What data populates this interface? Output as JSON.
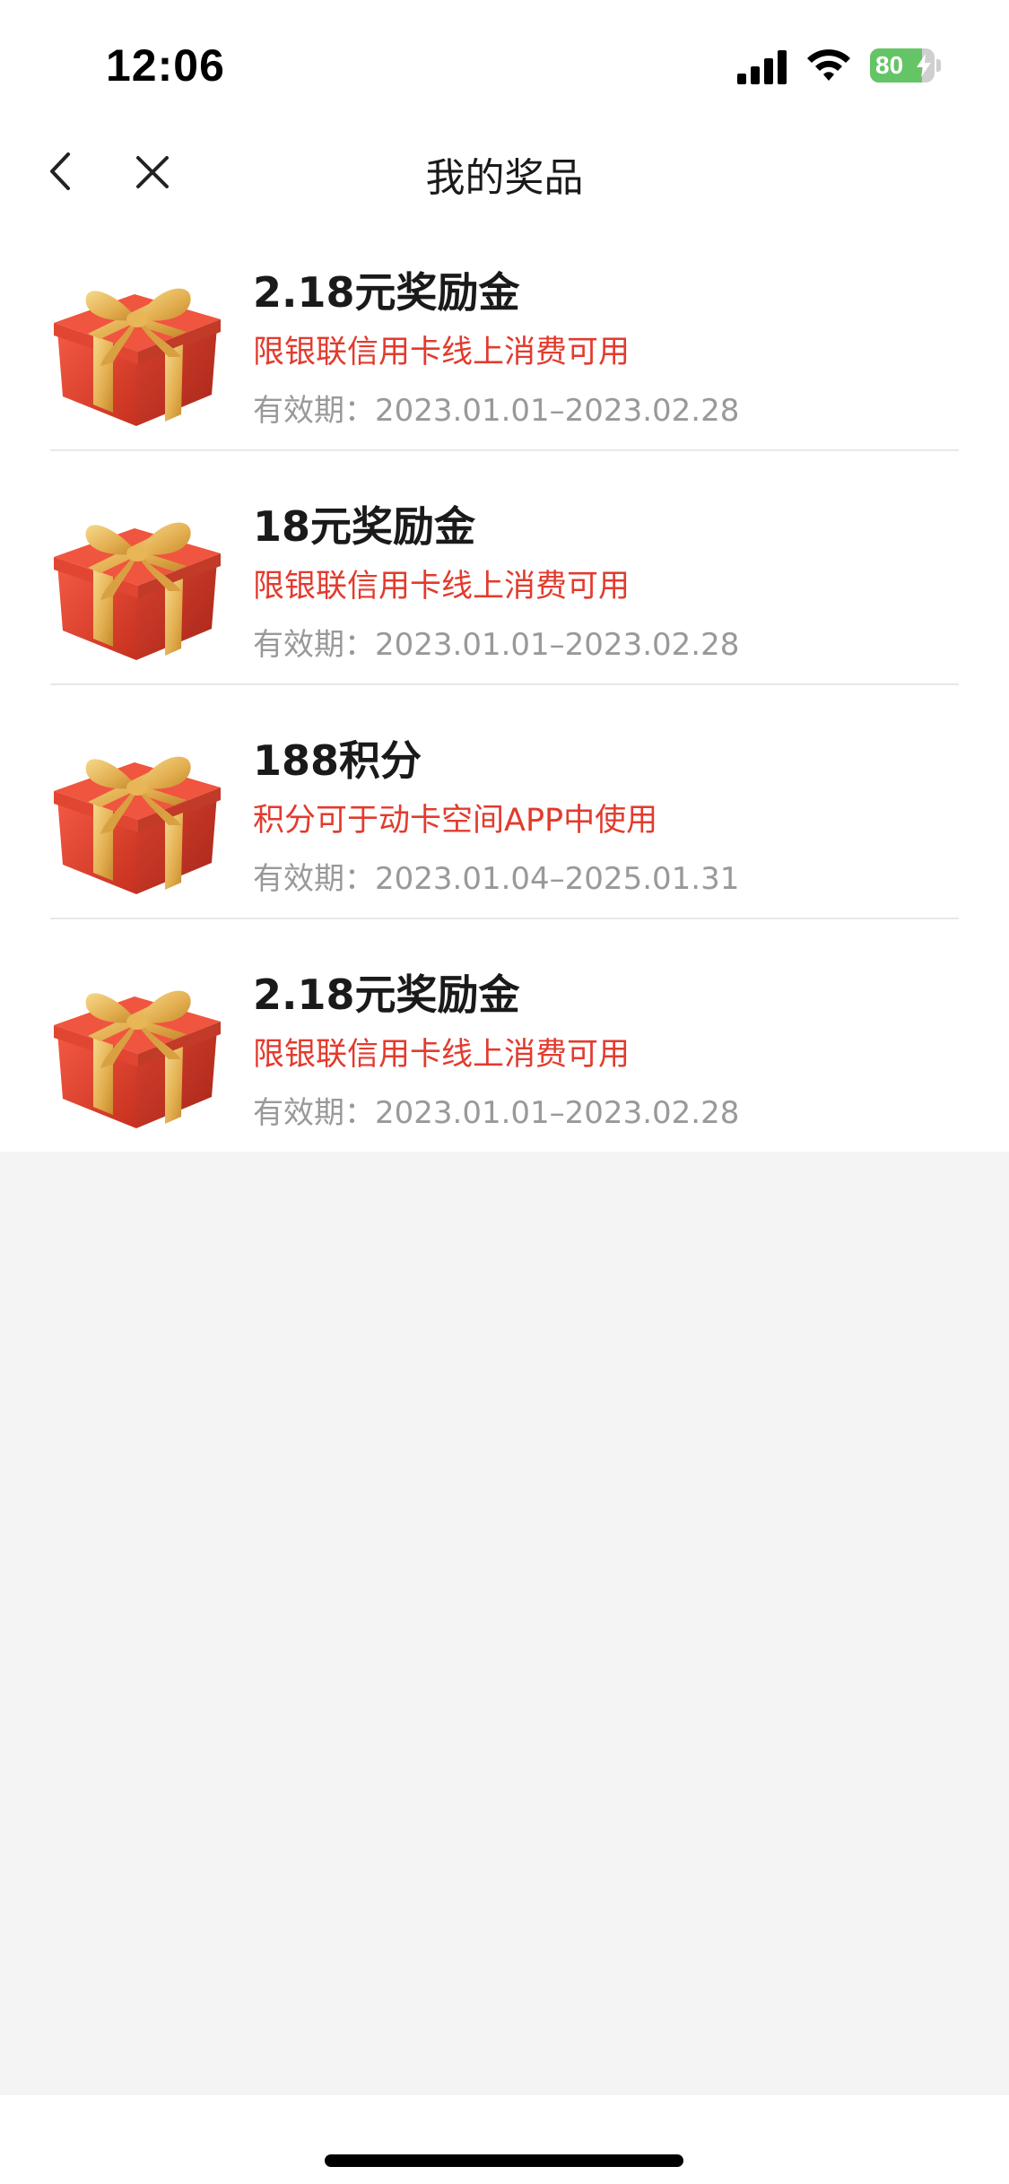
{
  "status_bar": {
    "time": "12:06",
    "battery_level": "80",
    "battery_fraction": 0.8,
    "battery_color": "#65c466",
    "icons": [
      "signal-icon",
      "wifi-icon",
      "battery-icon",
      "charging-bolt-icon"
    ]
  },
  "nav": {
    "title": "我的奖品",
    "back_icon": "chevron-left-icon",
    "close_icon": "close-icon"
  },
  "colors": {
    "description_red": "#e23b2e",
    "validity_gray": "#999999",
    "gift_red": "#e8402f",
    "ribbon_gold": "#e9b95a"
  },
  "prizes": [
    {
      "name": "2.18元奖励金",
      "description": "限银联信用卡线上消费可用",
      "validity": "有效期：2023.01.01–2023.02.28",
      "icon": "gift-box-icon"
    },
    {
      "name": "18元奖励金",
      "description": "限银联信用卡线上消费可用",
      "validity": "有效期：2023.01.01–2023.02.28",
      "icon": "gift-box-icon"
    },
    {
      "name": "188积分",
      "description": "积分可于动卡空间APP中使用",
      "validity": "有效期：2023.01.04–2025.01.31",
      "icon": "gift-box-icon"
    },
    {
      "name": "2.18元奖励金",
      "description": "限银联信用卡线上消费可用",
      "validity": "有效期：2023.01.01–2023.02.28",
      "icon": "gift-box-icon"
    }
  ]
}
